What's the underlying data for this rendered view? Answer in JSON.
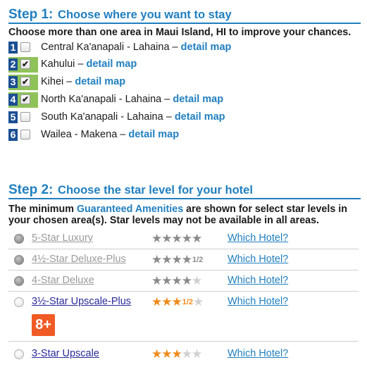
{
  "step1": {
    "title_num": "Step 1:",
    "title_rest": "Choose where you want to stay",
    "intro": "Choose more than one area in Maui Island, HI to improve your chances.",
    "detail_label": "detail map",
    "areas": [
      {
        "num": "1",
        "name": "Central Ka'anapali - Lahaina –",
        "checked": false,
        "check": ""
      },
      {
        "num": "2",
        "name": "Kahului –",
        "checked": true,
        "check": "✔"
      },
      {
        "num": "3",
        "name": "Kihei –",
        "checked": true,
        "check": "✔"
      },
      {
        "num": "4",
        "name": "North Ka'anapali - Lahaina –",
        "checked": true,
        "check": "✔"
      },
      {
        "num": "5",
        "name": "South Ka'anapali - Lahaina –",
        "checked": false,
        "check": ""
      },
      {
        "num": "6",
        "name": "Wailea - Makena –",
        "checked": false,
        "check": ""
      }
    ]
  },
  "step2": {
    "title_num": "Step 2:",
    "title_rest": "Choose the star level for your hotel",
    "intro_a": "The minimum",
    "intro_link": "Guaranteed Amenities",
    "intro_b": "are shown for select star levels in your chosen area(s). Star levels may not be available in all areas.",
    "which_label": "Which Hotel?",
    "levels": [
      {
        "label": "5-Star Luxury",
        "stars": 5,
        "half": "",
        "enabled": false
      },
      {
        "label": "4½-Star Deluxe-Plus",
        "stars": 4,
        "half": "1/2",
        "enabled": false
      },
      {
        "label": "4-Star Deluxe",
        "stars": 4,
        "half": "",
        "enabled": false
      },
      {
        "label": "3½-Star Upscale-Plus",
        "stars": 3,
        "half": "1/2",
        "enabled": true
      },
      {
        "label": "3-Star Upscale",
        "stars": 3,
        "half": "",
        "enabled": true
      }
    ],
    "age_badge": "8+"
  },
  "colors": {
    "accent": "#1f7fbf",
    "badge_bg": "#1b4f93",
    "selected_bg": "#8fc35a",
    "star_active": "#f08a1c",
    "star_disabled": "#8a8a8a",
    "star_empty": "#d0d0d0",
    "age_badge_bg": "#f05a24"
  },
  "icons": {
    "star": "star-icon",
    "radio": "radio-icon",
    "checkbox": "checkbox-icon"
  }
}
